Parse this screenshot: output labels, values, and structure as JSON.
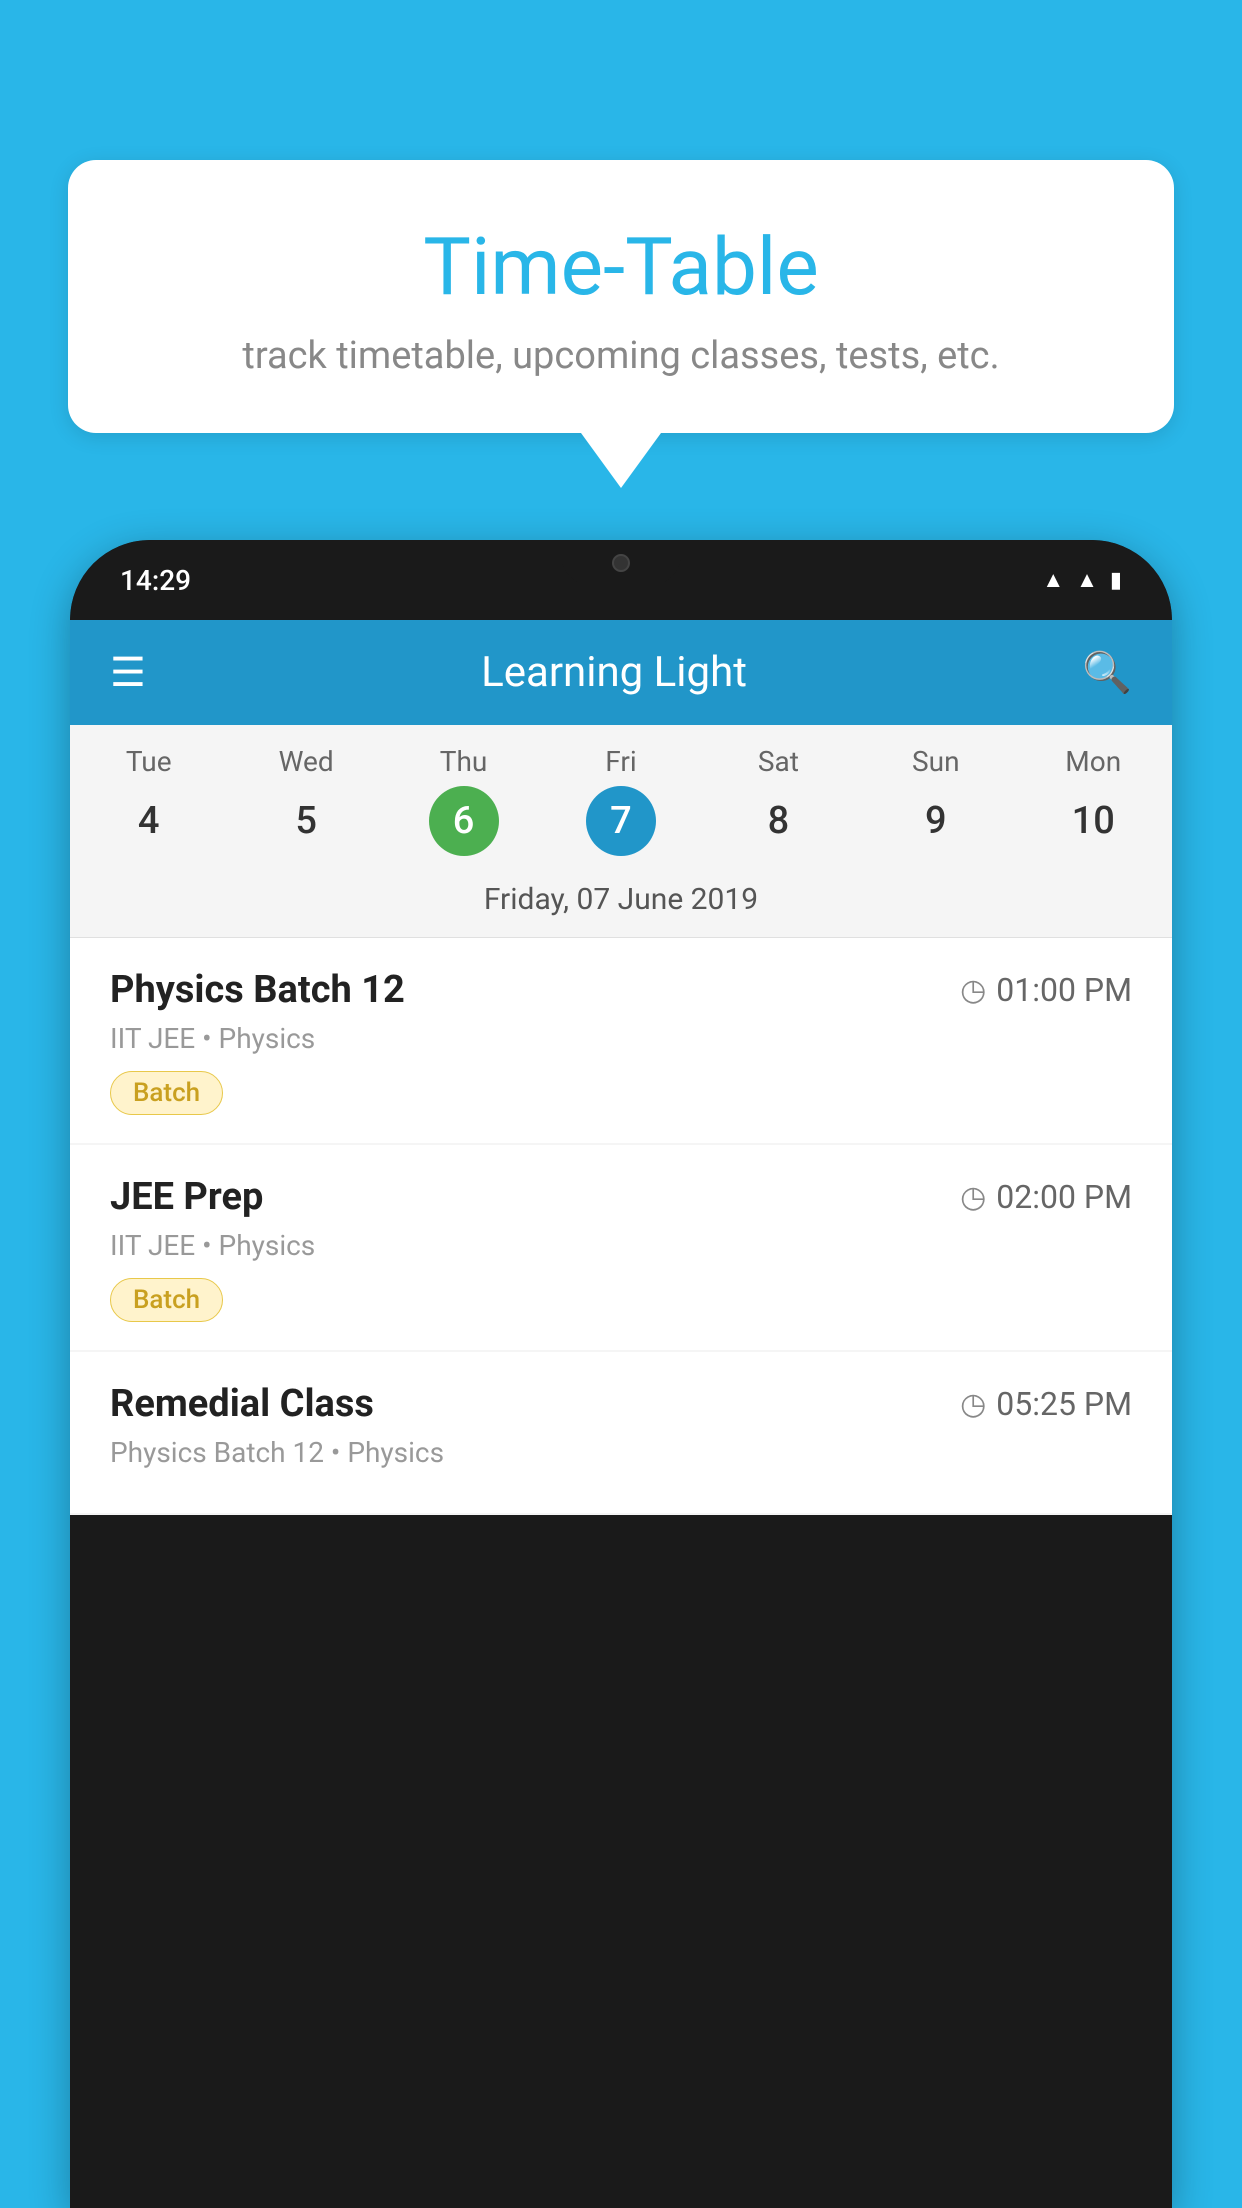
{
  "background_color": "#29B6E8",
  "speech_bubble": {
    "title": "Time-Table",
    "subtitle": "track timetable, upcoming classes, tests, etc."
  },
  "phone": {
    "status_bar": {
      "time": "14:29",
      "icons": [
        "wifi",
        "signal",
        "battery"
      ]
    },
    "app_bar": {
      "title": "Learning Light",
      "menu_icon": "☰",
      "search_icon": "🔍"
    },
    "calendar": {
      "days": [
        {
          "name": "Tue",
          "num": "4",
          "state": "normal"
        },
        {
          "name": "Wed",
          "num": "5",
          "state": "normal"
        },
        {
          "name": "Thu",
          "num": "6",
          "state": "today"
        },
        {
          "name": "Fri",
          "num": "7",
          "state": "selected"
        },
        {
          "name": "Sat",
          "num": "8",
          "state": "normal"
        },
        {
          "name": "Sun",
          "num": "9",
          "state": "normal"
        },
        {
          "name": "Mon",
          "num": "10",
          "state": "normal"
        }
      ],
      "selected_date_label": "Friday, 07 June 2019"
    },
    "classes": [
      {
        "name": "Physics Batch 12",
        "time": "01:00 PM",
        "meta": "IIT JEE • Physics",
        "badge": "Batch"
      },
      {
        "name": "JEE Prep",
        "time": "02:00 PM",
        "meta": "IIT JEE • Physics",
        "badge": "Batch"
      },
      {
        "name": "Remedial Class",
        "time": "05:25 PM",
        "meta": "Physics Batch 12 • Physics",
        "badge": null
      }
    ]
  }
}
